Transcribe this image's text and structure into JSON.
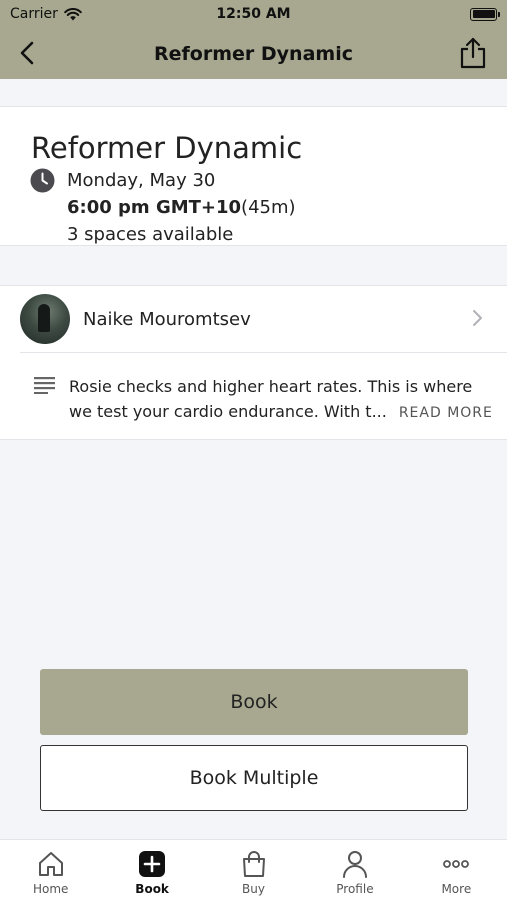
{
  "status_bar": {
    "carrier": "Carrier",
    "time": "12:50 AM"
  },
  "nav": {
    "title": "Reformer Dynamic",
    "back_icon": "chevron-left-icon",
    "share_icon": "share-icon"
  },
  "class_info": {
    "title": "Reformer Dynamic",
    "date": "Monday, May 30",
    "time": "6:00 pm GMT+10",
    "duration": "(45m)",
    "spaces": "3 spaces available"
  },
  "instructor": {
    "name": "Naike Mouromtsev"
  },
  "description": {
    "line1": "Rosie checks and higher heart rates. This is where",
    "line2": "we test your cardio endurance. With t...",
    "read_more": "READ MORE"
  },
  "actions": {
    "book_label": "Book",
    "book_multiple_label": "Book Multiple"
  },
  "colors": {
    "accent": "#a7a88f"
  },
  "tabs": [
    {
      "label": "Home",
      "icon": "home-icon"
    },
    {
      "label": "Book",
      "icon": "plus-square-icon",
      "active": true
    },
    {
      "label": "Buy",
      "icon": "shopping-bag-icon"
    },
    {
      "label": "Profile",
      "icon": "person-icon"
    },
    {
      "label": "More",
      "icon": "more-dots-icon"
    }
  ]
}
